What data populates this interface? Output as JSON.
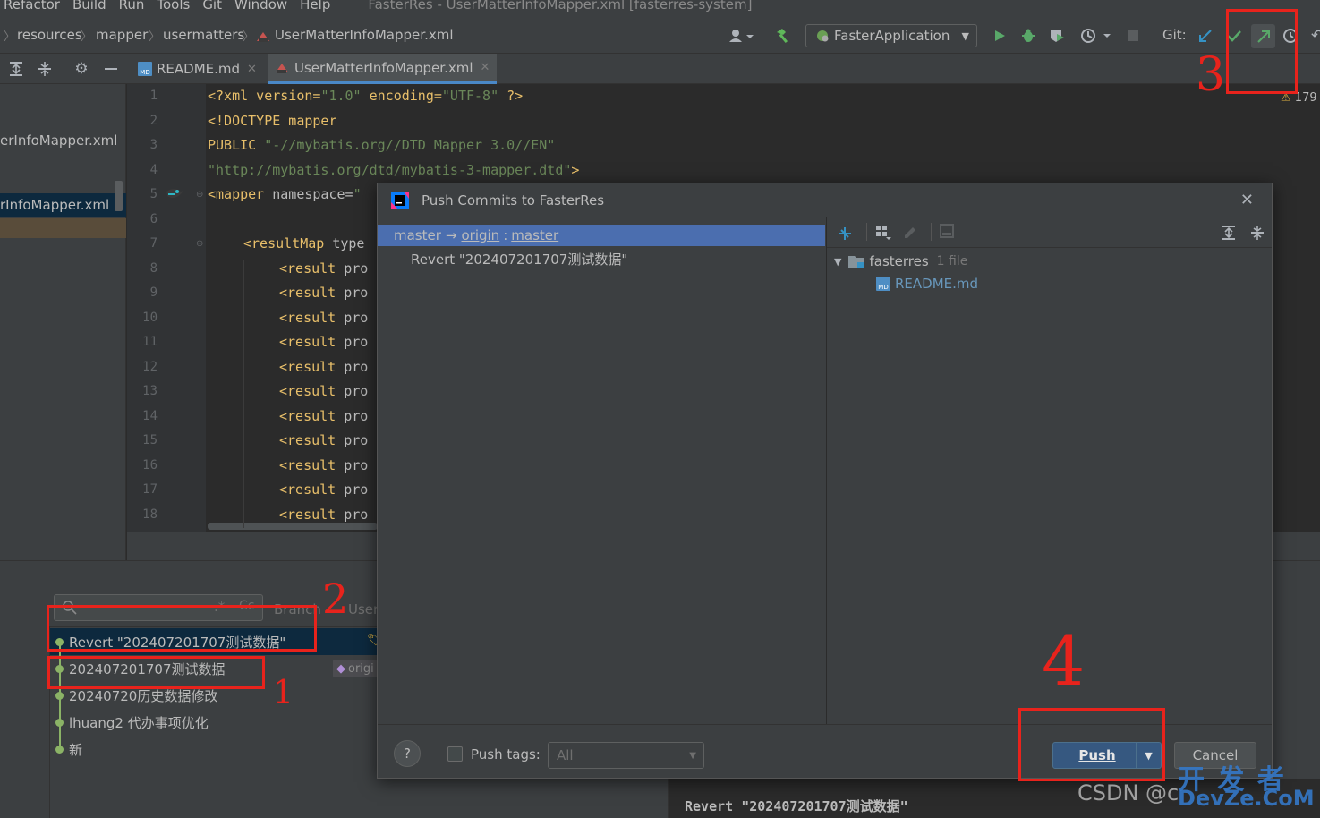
{
  "menu": {
    "items": [
      "Refactor",
      "Build",
      "Run",
      "Tools",
      "Git",
      "Window",
      "Help"
    ],
    "window_title": "FasterRes - UserMatterInfoMapper.xml [fasterres-system]"
  },
  "breadcrumb": {
    "items": [
      "resources",
      "mapper",
      "usermatters",
      "UserMatterInfoMapper.xml"
    ]
  },
  "toolbar": {
    "run_config": "FasterApplication",
    "git_label": "Git:"
  },
  "tabs": [
    {
      "label": "README.md",
      "icon": "markdown-file-icon"
    },
    {
      "label": "UserMatterInfoMapper.xml",
      "icon": "xml-mapper-file-icon",
      "active": true
    }
  ],
  "project_panel": {
    "items": [
      "erInfoMapper.xml",
      "rInfoMapper.xml"
    ]
  },
  "editor": {
    "line_numbers": [
      "1",
      "2",
      "3",
      "4",
      "5",
      "6",
      "7",
      "8",
      "9",
      "10",
      "11",
      "12",
      "13",
      "14",
      "15",
      "16",
      "17",
      "18"
    ],
    "lines": {
      "l1a": "<?xml version=",
      "l1b": "\"1.0\"",
      "l1c": " encoding=",
      "l1d": "\"UTF-8\"",
      "l1e": " ?>",
      "l2": "<!DOCTYPE mapper",
      "l3a": "PUBLIC ",
      "l3b": "\"-//mybatis.org//DTD Mapper 3.0//EN\"",
      "l4a": "\"http://mybatis.org/dtd/mybatis-3-mapper.dtd\"",
      "l4b": ">",
      "l5a": "<mapper",
      "l5b": " namespace=",
      "l5c": "\"",
      "l7a": "<resultMap",
      "l7b": " type",
      "result_tag": "<result",
      "result_attr": " pro"
    },
    "warning_count": "179"
  },
  "git_log": {
    "search_placeholder": "",
    "branch_label": "Branch",
    "user_label": "User",
    "commits": [
      "Revert \"202407201707测试数据\"",
      "202407201707测试数据",
      "20240720历史数据修改",
      "lhuang2 代办事项优化",
      "新"
    ],
    "tag_label": "origi",
    "details_text": "Revert \"202407201707测试数据\""
  },
  "dialog": {
    "title": "Push Commits to FasterRes",
    "branch_row": {
      "local": "master",
      "arrow": "→",
      "remote": "origin",
      "colon": ":",
      "remote_branch": "master"
    },
    "commit_entry": "Revert \"202407201707测试数据\"",
    "tree": {
      "folder": "fasterres",
      "folder_count": "1 file",
      "file": "README.md"
    },
    "push_tags_label": "Push tags:",
    "tags_select": "All",
    "push_button": "Push",
    "cancel_button": "Cancel",
    "help_button": "?"
  },
  "annotations": {
    "n1": "1",
    "n2": "2",
    "n3": "3",
    "n4": "4"
  },
  "watermark": {
    "csdn": "CSDN @c",
    "site_top": "开 发 者",
    "site_bottom": "DevZe.CoM"
  },
  "colors": {
    "selection": "#4b6eaf",
    "accent_blue": "#589df6",
    "annotation_red": "#e8231c",
    "push_button": "#365880"
  }
}
